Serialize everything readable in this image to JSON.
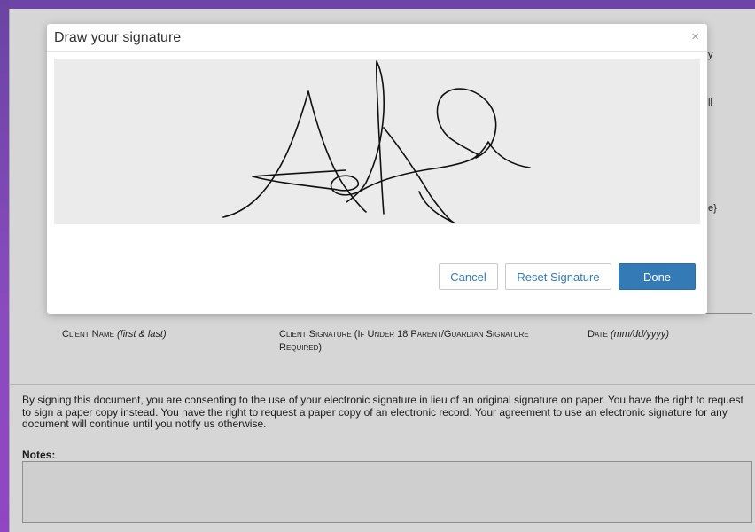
{
  "modal": {
    "title": "Draw your signature",
    "close_glyph": "×",
    "buttons": {
      "cancel": "Cancel",
      "reset": "Reset Signature",
      "done": "Done"
    }
  },
  "background_page": {
    "peek_right": [
      "y",
      "ll",
      "e}"
    ],
    "labels": {
      "client_name": "Client Name",
      "client_name_hint": "(first & last)",
      "client_signature": "Client Signature (If Under 18 Parent/Guardian Signature Required)",
      "date": "Date",
      "date_hint": "(mm/dd/yyyy)"
    },
    "consent_text": "By signing this document, you are consenting to the use of your electronic signature in lieu of an original signature on paper. You have the right to request to sign a paper copy instead. You have the right to request a paper copy of an electronic record. Your agreement to use an electronic signature for any document will continue until you notify us otherwise.",
    "notes_label": "Notes:",
    "notes_value": ""
  },
  "colors": {
    "primary": "#337ab7",
    "frame_purple": "#6e44a6"
  }
}
